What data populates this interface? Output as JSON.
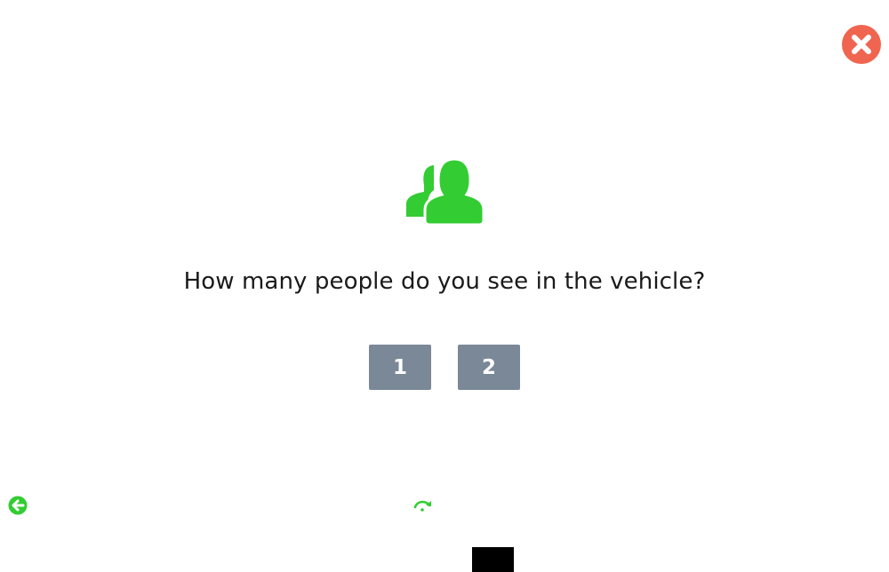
{
  "dialog": {
    "question": "How many people do you see in the vehicle?",
    "options": [
      {
        "label": "1"
      },
      {
        "label": "2"
      }
    ]
  },
  "icons": {
    "close": "close-icon",
    "hero": "people-icon",
    "back": "arrow-left-circle-icon",
    "redo": "redo-icon"
  },
  "colors": {
    "accent_green": "#33cc33",
    "close_red": "#f0654f",
    "button_gray": "#7a8898"
  }
}
